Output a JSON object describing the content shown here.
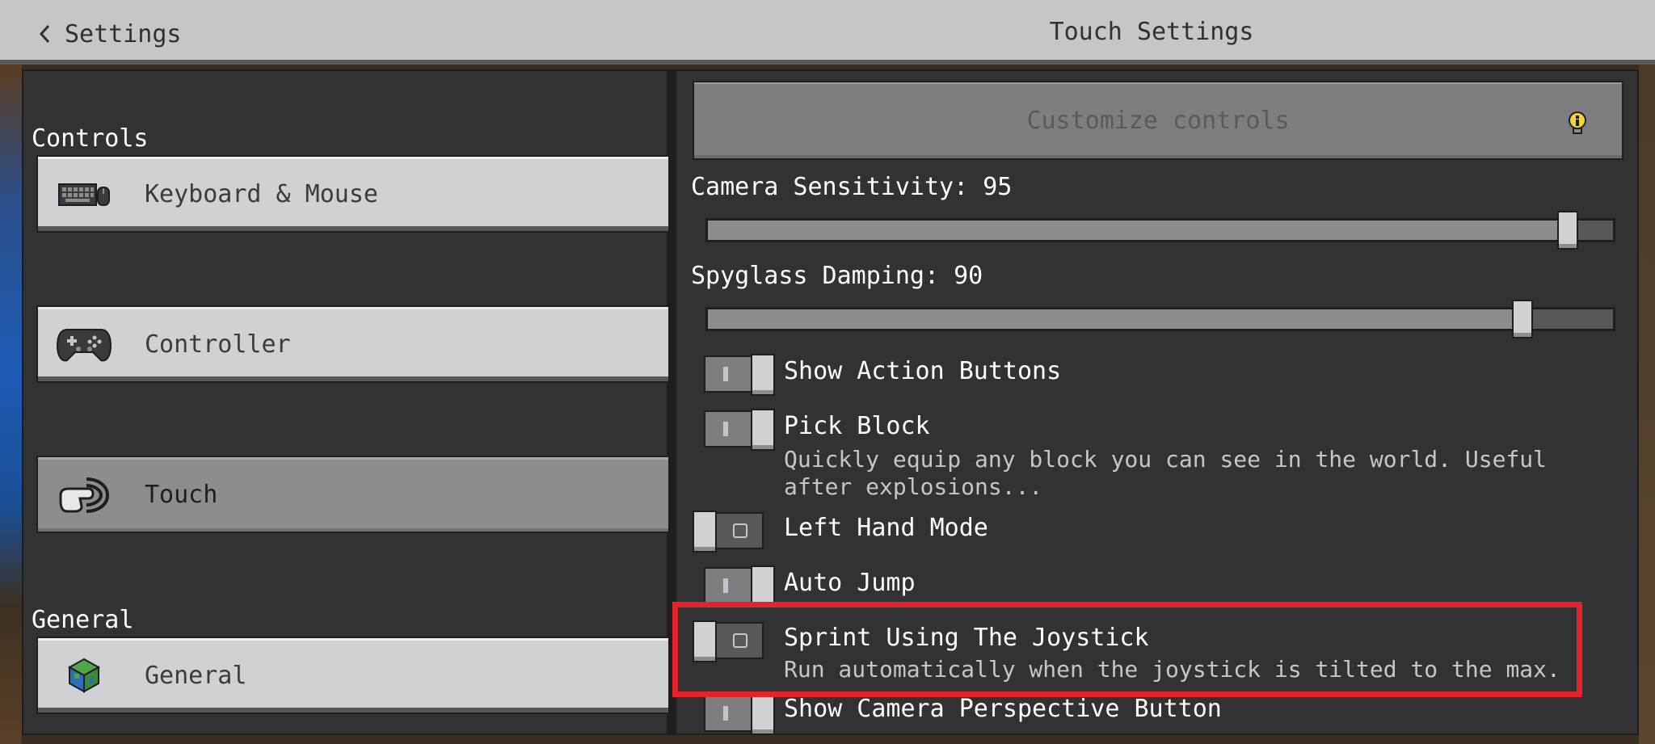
{
  "header": {
    "back_label": "Settings",
    "title": "Touch Settings"
  },
  "sidebar": {
    "sections": [
      {
        "label": "Controls",
        "items": [
          {
            "label": "Keyboard & Mouse",
            "icon": "keyboard-mouse-icon",
            "selected": false
          },
          {
            "label": "Controller",
            "icon": "gamepad-icon",
            "selected": false
          },
          {
            "label": "Touch",
            "icon": "touch-hand-icon",
            "selected": true
          }
        ]
      },
      {
        "label": "General",
        "items": [
          {
            "label": "General",
            "icon": "globe-cube-icon",
            "selected": false
          }
        ]
      }
    ]
  },
  "main": {
    "customize_button": {
      "label": "Customize controls",
      "icon": "info-bulb-icon"
    },
    "sliders": [
      {
        "label": "Camera Sensitivity: 95",
        "value": 95,
        "max": 100
      },
      {
        "label": "Spyglass Damping: 90",
        "value": 90,
        "max": 100
      }
    ],
    "toggles": [
      {
        "label": "Show Action Buttons",
        "state": true,
        "description": ""
      },
      {
        "label": "Pick Block",
        "state": true,
        "description": "Quickly equip any block you can see in the world. Useful after explosions..."
      },
      {
        "label": "Left Hand Mode",
        "state": false,
        "description": ""
      },
      {
        "label": "Auto Jump",
        "state": true,
        "description": ""
      },
      {
        "label": "Sprint Using The Joystick",
        "state": false,
        "description": "Run automatically when the joystick is tilted to the max.",
        "highlighted": true
      },
      {
        "label": "Show Camera Perspective Button",
        "state": true,
        "description": ""
      }
    ]
  },
  "colors": {
    "highlight": "#e5232a",
    "panel_bg": "#313233",
    "topbar_bg": "#c6c6c6",
    "button_bg": "#d0d1d4",
    "selected_bg": "#8c8d90"
  }
}
